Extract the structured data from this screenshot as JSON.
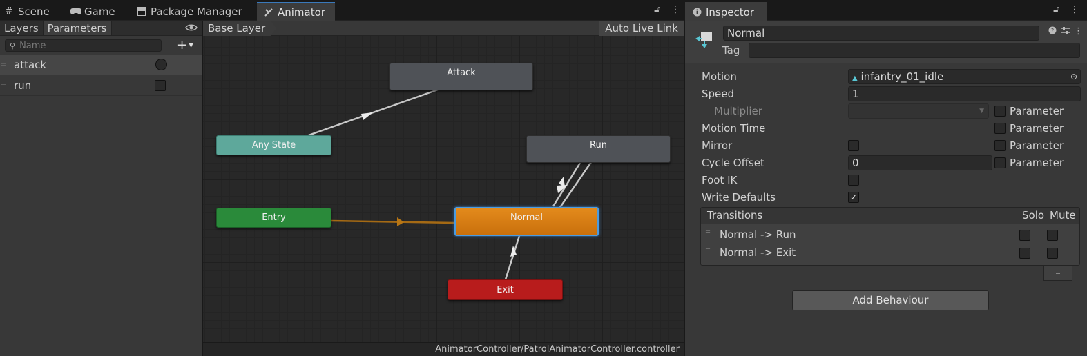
{
  "tabs": {
    "left": [
      {
        "label": "Scene",
        "icon": "grid-icon"
      },
      {
        "label": "Game",
        "icon": "gamepad-icon"
      },
      {
        "label": "Package Manager",
        "icon": "package-icon"
      },
      {
        "label": "Animator",
        "icon": "animator-icon"
      }
    ],
    "right": {
      "label": "Inspector",
      "icon": "info-icon"
    }
  },
  "parameters_panel": {
    "tabs": [
      "Layers",
      "Parameters"
    ],
    "search_placeholder": "Name",
    "items": [
      {
        "name": "attack",
        "type": "trigger"
      },
      {
        "name": "run",
        "type": "bool",
        "value": false
      }
    ]
  },
  "graph": {
    "breadcrumb": "Base Layer",
    "auto_live_link": "Auto Live Link",
    "footer_path": "AnimatorController/PatrolAnimatorController.controller",
    "nodes": {
      "attack": "Attack",
      "any_state": "Any State",
      "run": "Run",
      "entry": "Entry",
      "normal": "Normal",
      "exit": "Exit"
    }
  },
  "inspector": {
    "state_name": "Normal",
    "tag_label": "Tag",
    "tag_value": "",
    "fields": {
      "motion_label": "Motion",
      "motion_value": "infantry_01_idle",
      "speed_label": "Speed",
      "speed_value": "1",
      "multiplier_label": "Multiplier",
      "motion_time_label": "Motion Time",
      "mirror_label": "Mirror",
      "cycle_offset_label": "Cycle Offset",
      "cycle_offset_value": "0",
      "foot_ik_label": "Foot IK",
      "write_defaults_label": "Write Defaults",
      "parameter_label": "Parameter"
    },
    "write_defaults_checked": true,
    "transitions": {
      "header": "Transitions",
      "solo": "Solo",
      "mute": "Mute",
      "rows": [
        "Normal -> Run",
        "Normal -> Exit"
      ]
    },
    "add_behaviour": "Add Behaviour"
  },
  "colors": {
    "accent_blue": "#3a79bb",
    "any_state": "#5ea89b",
    "entry": "#2a8a3a",
    "normal": "#d97e12",
    "exit": "#b81c1c",
    "state_gray": "#4f5257",
    "entry_transition": "#a56a14"
  }
}
